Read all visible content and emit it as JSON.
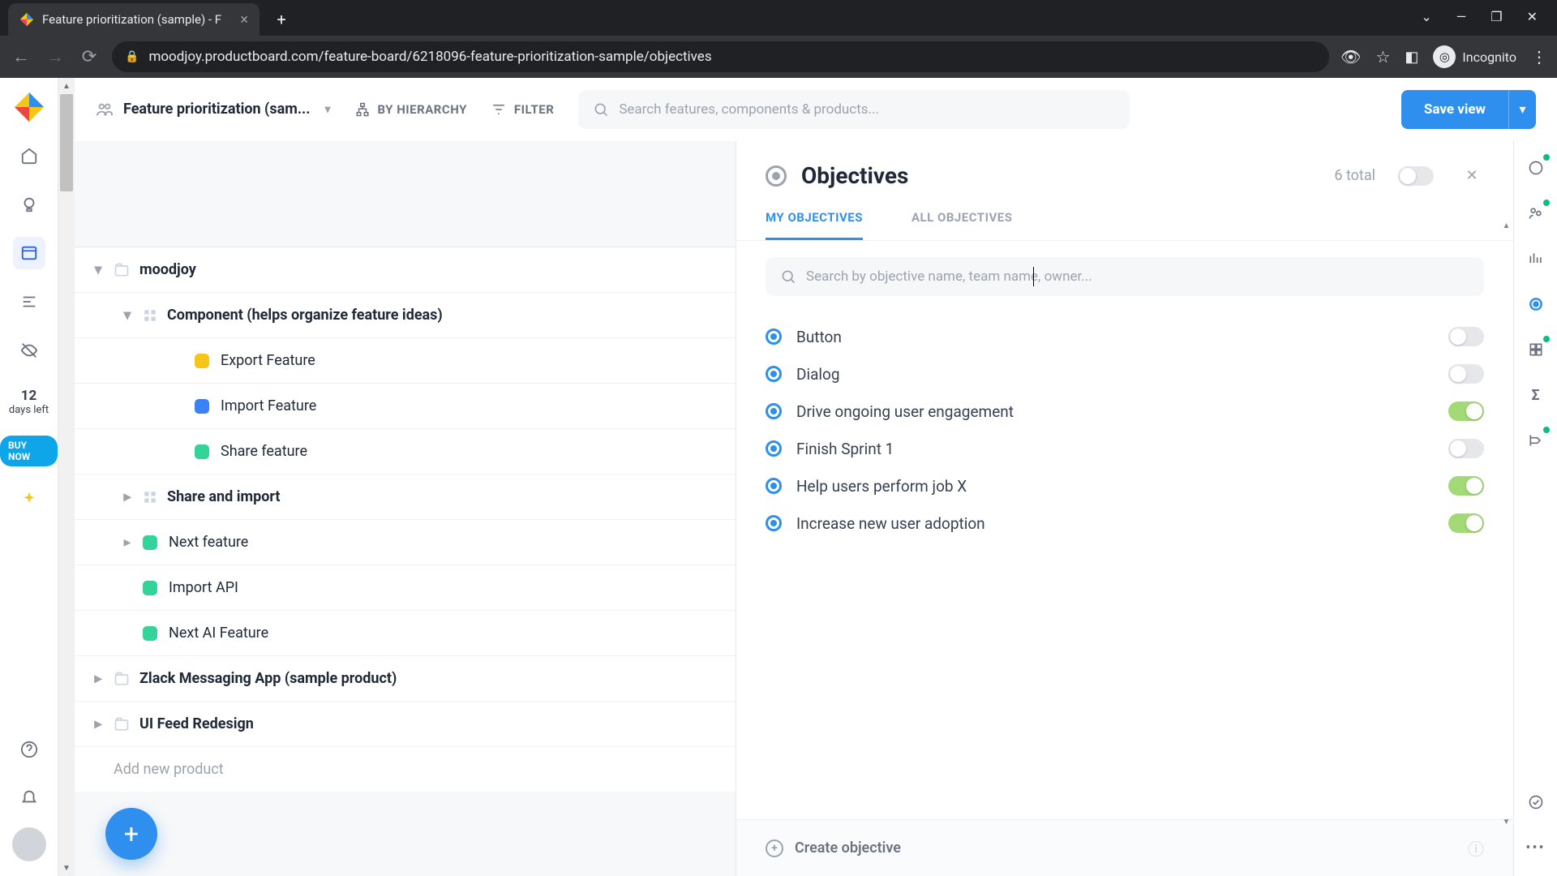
{
  "browser": {
    "tab_title": "Feature prioritization (sample) - F",
    "url": "moodjoy.productboard.com/feature-board/6218096-feature-prioritization-sample/objectives",
    "incognito_label": "Incognito"
  },
  "topbar": {
    "board_name": "Feature prioritization (sam...",
    "by_hierarchy": "BY HIERARCHY",
    "filter": "FILTER",
    "search_placeholder": "Search features, components & products...",
    "save_view": "Save view"
  },
  "rail": {
    "trial_days": "12",
    "trial_label": "days left",
    "buy": "BUY NOW"
  },
  "tree": {
    "items": [
      {
        "indent": 0,
        "caret": "down",
        "icon": "folder",
        "label": "moodjoy",
        "bold": true
      },
      {
        "indent": 1,
        "caret": "down",
        "icon": "grid",
        "label": "Component (helps organize feature ideas)",
        "bold": true
      },
      {
        "indent": 2,
        "caret": "",
        "icon": "sq",
        "color": "#f5c518",
        "label": "Export Feature"
      },
      {
        "indent": 2,
        "caret": "",
        "icon": "sq",
        "color": "#3b82f6",
        "label": "Import Feature"
      },
      {
        "indent": 2,
        "caret": "",
        "icon": "sq",
        "color": "#34d399",
        "label": "Share feature"
      },
      {
        "indent": 1,
        "caret": "right",
        "icon": "grid",
        "label": "Share and import",
        "bold": true
      },
      {
        "indent": 1,
        "caret": "right",
        "icon": "sq",
        "color": "#34d399",
        "label": "Next feature"
      },
      {
        "indent": 1,
        "caret": "",
        "icon": "sq",
        "color": "#34d399",
        "label": "Import API"
      },
      {
        "indent": 1,
        "caret": "",
        "icon": "sq",
        "color": "#34d399",
        "label": "Next AI Feature"
      },
      {
        "indent": 0,
        "caret": "right",
        "icon": "folder",
        "label": "Zlack Messaging App (sample product)",
        "bold": true
      },
      {
        "indent": 0,
        "caret": "right",
        "icon": "folder",
        "label": "UI Feed Redesign",
        "bold": true
      },
      {
        "indent": 0,
        "caret": "",
        "icon": "",
        "label": "Add new product",
        "addnew": true
      }
    ]
  },
  "panel": {
    "title": "Objectives",
    "count": "6 total",
    "tabs": {
      "my": "MY OBJECTIVES",
      "all": "ALL OBJECTIVES"
    },
    "search_placeholder": "Search by objective name, team name, owner...",
    "objectives": [
      {
        "label": "Button",
        "on": false
      },
      {
        "label": "Dialog",
        "on": false
      },
      {
        "label": "Drive ongoing user engagement",
        "on": true
      },
      {
        "label": "Finish Sprint 1",
        "on": false
      },
      {
        "label": "Help users perform job X",
        "on": true
      },
      {
        "label": "Increase new user adoption",
        "on": true
      }
    ],
    "create": "Create objective"
  }
}
